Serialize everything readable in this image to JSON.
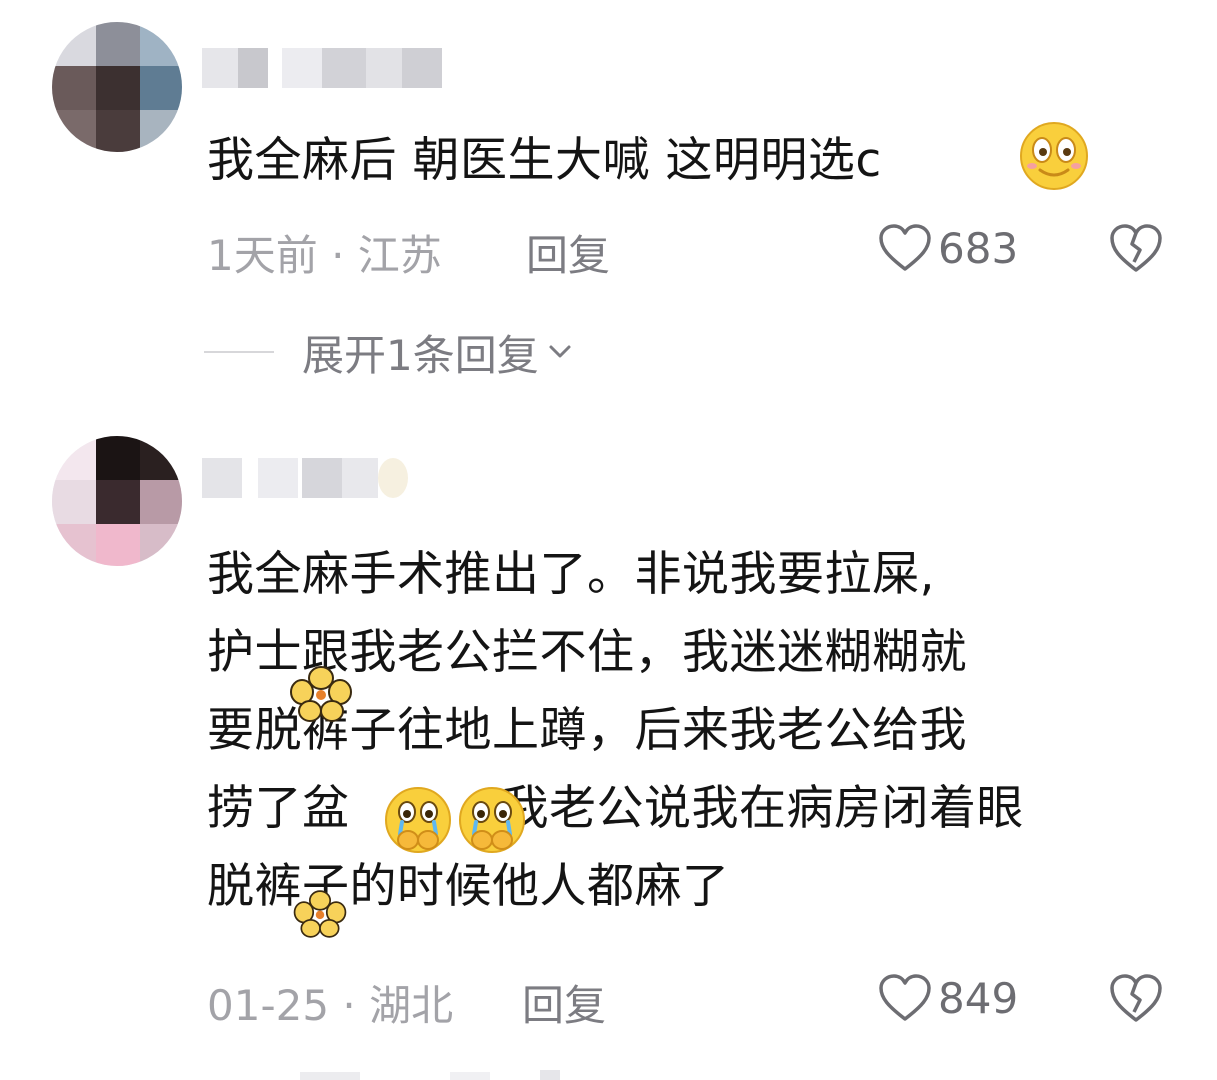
{
  "comments": [
    {
      "text_lines": [
        "我全麻后 朝医生大喊 这明明选c"
      ],
      "time": "1天前",
      "location": "江苏",
      "meta": "1天前 · 江苏",
      "reply_label": "回复",
      "likes": "683",
      "expand_replies": "展开1条回复",
      "inline_emoji": "smile-emoji",
      "icons": [
        "heart-icon",
        "broken-heart-icon",
        "chevron-down-icon"
      ]
    },
    {
      "text_lines": [
        "我全麻手术推出了。非说我要拉屎,",
        "护士跟我老公拦不住，我迷迷糊糊就",
        "要脱裤子往地上蹲，后来我老公给我",
        "捞了盆",
        "我老公说我在病房闭着眼",
        "脱裤子的时候他人都麻了"
      ],
      "meta": "01-25 · 湖北",
      "reply_label": "回复",
      "likes": "849",
      "inline_emoji": "crying-hands-emoji",
      "icons": [
        "heart-icon",
        "broken-heart-icon"
      ]
    }
  ],
  "colors": {
    "text": "#141414",
    "meta": "#a3a3a8",
    "reply": "#7c7c82",
    "divider": "#d7d7da",
    "emoji_yellow": "#f9cf3c"
  }
}
